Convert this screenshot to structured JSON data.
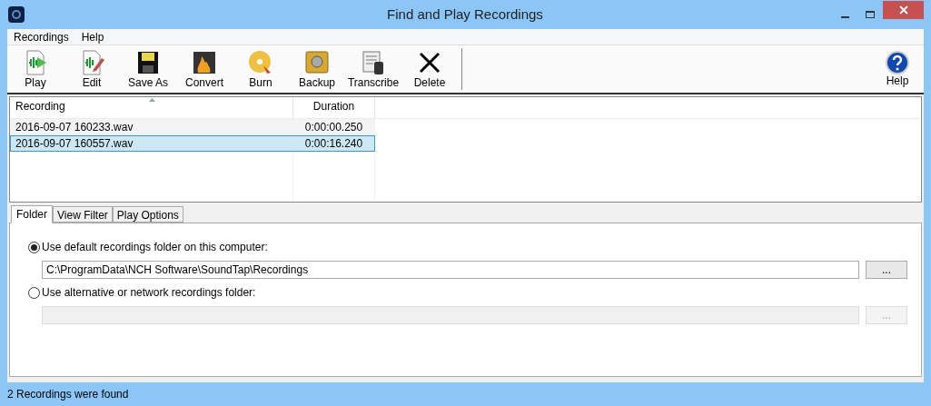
{
  "window": {
    "title": "Find and Play Recordings"
  },
  "menu": [
    "Recordings",
    "Help"
  ],
  "toolbar": [
    "Play",
    "Edit",
    "Save As",
    "Convert",
    "Burn",
    "Backup",
    "Transcribe",
    "Delete"
  ],
  "help_button": "Help",
  "table": {
    "columns": [
      "Recording",
      "Duration"
    ],
    "rows": [
      {
        "name": "2016-09-07 160233.wav",
        "duration": "0:00:00.250",
        "selected": false
      },
      {
        "name": "2016-09-07 160557.wav",
        "duration": "0:00:16.240",
        "selected": true
      }
    ]
  },
  "tabs": [
    {
      "label": "Folder",
      "selected": true
    },
    {
      "label": "View Filter",
      "selected": false
    },
    {
      "label": "Play Options",
      "selected": false
    }
  ],
  "options": [
    {
      "label": "Use default recordings folder on this computer:",
      "selected": true,
      "value": "C:\\ProgramData\\NCH Software\\SoundTap\\Recordings",
      "browse": "...",
      "disabled": false
    },
    {
      "label": "Use alternative or network recordings folder:",
      "selected": false,
      "browse": "...",
      "disabled": true
    }
  ],
  "status_bar": "2 Recordings were found"
}
